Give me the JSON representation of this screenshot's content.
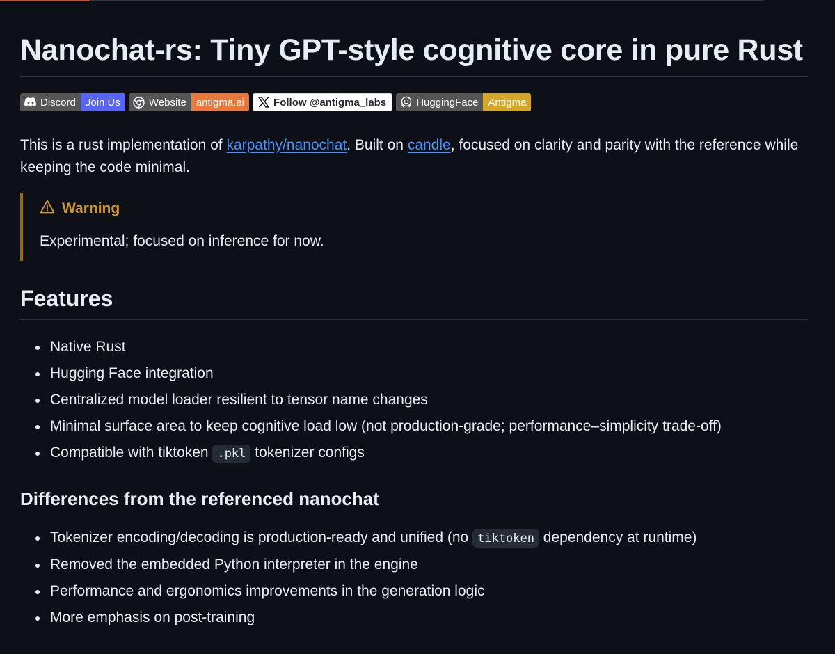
{
  "title": "Nanochat-rs: Tiny GPT-style cognitive core in pure Rust",
  "badges": [
    {
      "left": "Discord",
      "right": "Join Us",
      "right_color": "#5865F2",
      "icon": "discord-icon"
    },
    {
      "left": "Website",
      "right": "antigma.ai",
      "right_color": "#E8793C",
      "icon": "chrome-icon"
    },
    {
      "left": "Follow @antigma_labs",
      "icon": "x-logo-icon"
    },
    {
      "left": "HuggingFace",
      "right": "Antigma",
      "right_color": "#D4A62A",
      "icon": "huggingface-icon"
    }
  ],
  "intro": {
    "before_link1": "This is a rust implementation of ",
    "link1": "karpathy/nanochat",
    "between_links": ". Built on ",
    "link2": "candle",
    "after_link2": ", focused on clarity and parity with the reference while keeping the code minimal."
  },
  "warning": {
    "title": "Warning",
    "body": "Experimental; focused on inference for now."
  },
  "features": {
    "heading": "Features",
    "items": [
      "Native Rust",
      "Hugging Face integration",
      "Centralized model loader resilient to tensor name changes",
      "Minimal surface area to keep cognitive load low (not production-grade; performance–simplicity trade-off)"
    ],
    "last_item": {
      "before": "Compatible with tiktoken ",
      "code": ".pkl",
      "after": " tokenizer configs"
    }
  },
  "differences": {
    "heading": "Differences from the referenced nanochat",
    "first_item": {
      "before": "Tokenizer encoding/decoding is production-ready and unified (no ",
      "code": "tiktoken",
      "after": " dependency at runtime)"
    },
    "items": [
      "Removed the embedded Python interpreter in the engine",
      "Performance and ergonomics improvements in the generation logic",
      "More emphasis on post-training"
    ]
  },
  "colors": {
    "background": "#0d1117",
    "text": "#e6edf3",
    "link": "#4493f8",
    "warning": "#d29922",
    "warning_border": "#9e6a03"
  }
}
